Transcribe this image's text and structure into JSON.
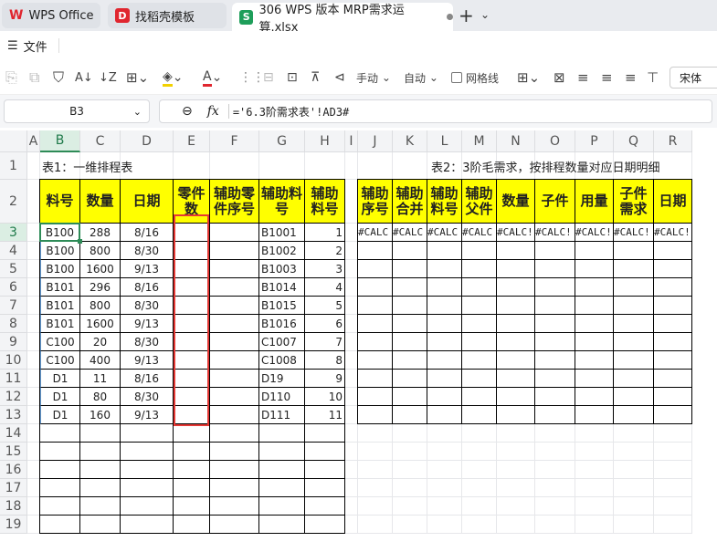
{
  "tabs": [
    {
      "label": "WPS Office",
      "icon": "wps-logo-icon"
    },
    {
      "label": "找稻壳模板",
      "icon": "docer-icon"
    },
    {
      "label": "306 WPS 版本 MRP需求运算.xlsx",
      "icon": "spreadsheet-icon"
    }
  ],
  "menu": {
    "file": "文件"
  },
  "toolbar": {
    "manual": "手动",
    "auto": "自动",
    "gridlines": "网格线",
    "font": "宋体"
  },
  "formula": {
    "cell_ref": "B3",
    "fx": "fx",
    "content": "='6.3阶需求表'!AD3#"
  },
  "columns": [
    "A",
    "B",
    "C",
    "D",
    "E",
    "F",
    "G",
    "H",
    "I",
    "J",
    "K",
    "L",
    "M",
    "N",
    "O",
    "P",
    "Q",
    "R"
  ],
  "rows": [
    "1",
    "2",
    "3",
    "4",
    "5",
    "6",
    "7",
    "8",
    "9",
    "10",
    "11",
    "12",
    "13",
    "14",
    "15",
    "16",
    "17",
    "18",
    "19"
  ],
  "table1": {
    "title": "表1：一维排程表",
    "headers": [
      "料号",
      "数量",
      "日期",
      "零件数",
      "辅助零件序号",
      "辅助料号",
      "辅助料号"
    ],
    "rows": [
      [
        "B100",
        "288",
        "8/16",
        "",
        "",
        "B1001",
        "1"
      ],
      [
        "B100",
        "800",
        "8/30",
        "",
        "",
        "B1002",
        "2"
      ],
      [
        "B100",
        "1600",
        "9/13",
        "",
        "",
        "B1003",
        "3"
      ],
      [
        "B101",
        "296",
        "8/16",
        "",
        "",
        "B1014",
        "4"
      ],
      [
        "B101",
        "800",
        "8/30",
        "",
        "",
        "B1015",
        "5"
      ],
      [
        "B101",
        "1600",
        "9/13",
        "",
        "",
        "B1016",
        "6"
      ],
      [
        "C100",
        "20",
        "8/30",
        "",
        "",
        "C1007",
        "7"
      ],
      [
        "C100",
        "400",
        "9/13",
        "",
        "",
        "C1008",
        "8"
      ],
      [
        "D1",
        "11",
        "8/16",
        "",
        "",
        "D19",
        "9"
      ],
      [
        "D1",
        "80",
        "8/30",
        "",
        "",
        "D110",
        "10"
      ],
      [
        "D1",
        "160",
        "9/13",
        "",
        "",
        "D111",
        "11"
      ]
    ]
  },
  "table2": {
    "title": "表2：3阶毛需求，按排程数量对应日期明细",
    "headers": [
      "辅助序号",
      "辅助合并",
      "辅助料号",
      "辅助父件",
      "数量",
      "子件",
      "用量",
      "子件需求",
      "日期"
    ],
    "error_row": [
      "#CALC",
      "#CALC",
      "#CALC",
      "#CALC",
      "#CALC!",
      "#CALC!",
      "#CALC!",
      "#CALC!",
      "#CALC!"
    ]
  },
  "colors": {
    "header_fill": "#ffff00",
    "selection": "#2e8b57",
    "highlight_box": "#e53935"
  }
}
